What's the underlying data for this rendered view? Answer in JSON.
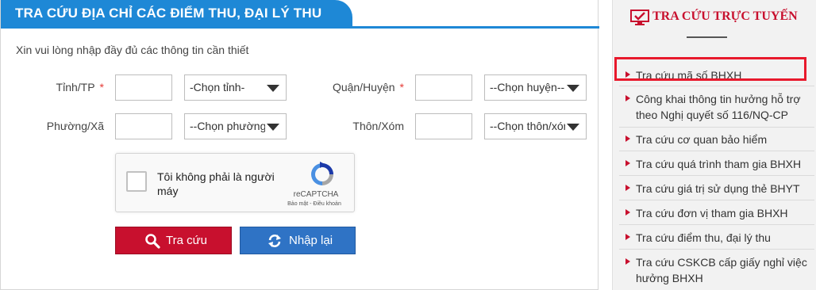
{
  "form": {
    "title": "TRA CỨU ĐỊA CHỈ CÁC ĐIỂM THU, ĐẠI LÝ THU",
    "intro": "Xin vui lòng nhập đầy đủ các thông tin cần thiết",
    "required_mark": "*",
    "province": {
      "label": "Tỉnh/TP",
      "code_value": "",
      "select_value": "-Chọn tỉnh-"
    },
    "district": {
      "label": "Quận/Huyện",
      "code_value": "",
      "select_value": "--Chọn huyện--"
    },
    "ward": {
      "label": "Phường/Xã",
      "code_value": "",
      "select_value": "--Chọn phường/"
    },
    "hamlet": {
      "label": "Thôn/Xóm",
      "code_value": "",
      "select_value": "--Chọn thôn/xóm"
    },
    "captcha": {
      "text": "Tôi không phải là người máy",
      "brand": "reCAPTCHA",
      "links": "Bảo mật - Điều khoản"
    },
    "buttons": {
      "search": "Tra cứu",
      "reset": "Nhập lại"
    }
  },
  "sidebar": {
    "title": "TRA CỨU TRỰC TUYẾN",
    "items": [
      {
        "label": "Tra cứu mã số BHXH",
        "highlighted": true
      },
      {
        "label": "Công khai thông tin hưởng hỗ trợ theo Nghị quyết số 116/NQ-CP"
      },
      {
        "label": "Tra cứu cơ quan bảo hiểm"
      },
      {
        "label": "Tra cứu quá trình tham gia BHXH"
      },
      {
        "label": "Tra cứu giá trị sử dụng thẻ BHYT"
      },
      {
        "label": "Tra cứu đơn vị tham gia BHXH"
      },
      {
        "label": "Tra cứu điểm thu, đại lý thu"
      },
      {
        "label": "Tra cứu CSKCB cấp giấy nghỉ việc hưởng BHXH"
      }
    ]
  },
  "colors": {
    "header_blue": "#1e88d6",
    "search_red": "#c8102e",
    "reset_blue": "#2f73c5",
    "highlight_red": "#e8192c"
  },
  "icons": {
    "search_button": "search-icon",
    "reset_button": "refresh-icon",
    "sidebar_title": "monitor-check-icon",
    "list_bullet": "triangle-right-icon",
    "select_caret": "caret-down-icon"
  }
}
